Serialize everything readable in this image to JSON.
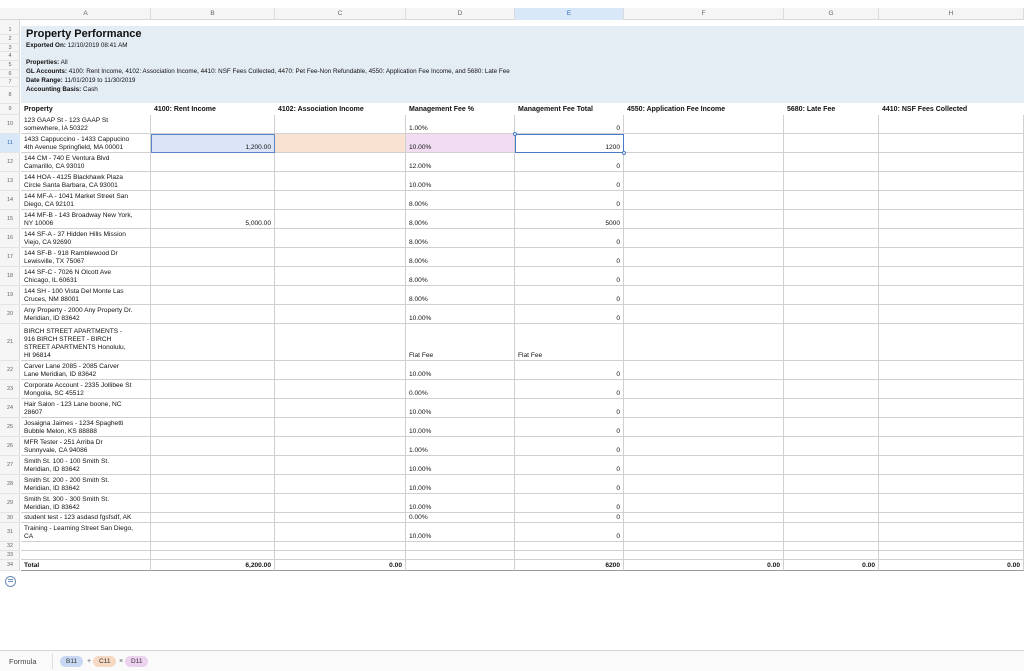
{
  "sheet": {
    "columns": [
      "A",
      "B",
      "C",
      "D",
      "E",
      "F",
      "G",
      "H"
    ],
    "active_column": "E",
    "active_row": "11",
    "row_numbers": [
      "1",
      "2",
      "3",
      "4",
      "5",
      "6",
      "7",
      "8",
      "9",
      "10",
      "11",
      "12",
      "13",
      "14",
      "15",
      "16",
      "17",
      "18",
      "19",
      "20",
      "21",
      "22",
      "23",
      "24",
      "25",
      "26",
      "27",
      "28",
      "29",
      "30",
      "31",
      "32",
      "33",
      "34"
    ]
  },
  "report": {
    "title": "Property Performance",
    "exported_label": "Exported On:",
    "exported_value": "12/10/2019 08:41 AM",
    "properties_label": "Properties:",
    "properties_value": "All",
    "gl_label": "GL Accounts:",
    "gl_value": "4100: Rent Income, 4102: Association Income, 4410: NSF Fees Collected, 4470: Pet Fee-Non Refundable, 4550: Application Fee Income, and 5680: Late Fee",
    "date_label": "Date Range:",
    "date_value": "11/01/2019 to 11/30/2019",
    "basis_label": "Accounting Basis:",
    "basis_value": "Cash"
  },
  "table": {
    "headers": [
      "Property",
      "4100: Rent Income",
      "4102: Association Income",
      "Management Fee %",
      "Management Fee Total",
      "4550: Application Fee Income",
      "5680: Late Fee",
      "4410: NSF Fees Collected"
    ],
    "rows": [
      {
        "p1": "123 GAAP St - 123 GAAP St",
        "p2": "somewhere, IA 50322",
        "p3": "",
        "p4": "",
        "b": "",
        "c": "",
        "d": "1.00%",
        "e": "0"
      },
      {
        "p1": "1433 Cappuccino - 1433 Cappucino",
        "p2": "4th Avenue Springfield, MA 00001",
        "p3": "",
        "p4": "",
        "b": "1,200.00",
        "c": "",
        "d": "10.00%",
        "e": "1200"
      },
      {
        "p1": "144 CM - 740 E Ventura Blvd",
        "p2": "Camarillo, CA 93010",
        "p3": "",
        "p4": "",
        "b": "",
        "c": "",
        "d": "12.00%",
        "e": "0"
      },
      {
        "p1": "144 HOA - 4125 Blackhawk Plaza",
        "p2": "Circle Santa Barbara, CA 93001",
        "p3": "",
        "p4": "",
        "b": "",
        "c": "",
        "d": "10.00%",
        "e": "0"
      },
      {
        "p1": "144 MF-A - 1041 Market Street San",
        "p2": "Diego, CA 92101",
        "p3": "",
        "p4": "",
        "b": "",
        "c": "",
        "d": "8.00%",
        "e": "0"
      },
      {
        "p1": "144 MF-B - 143 Broadway New York,",
        "p2": "NY 10006",
        "p3": "",
        "p4": "",
        "b": "5,000.00",
        "c": "",
        "d": "8.00%",
        "e": "5000"
      },
      {
        "p1": "144 SF-A - 37 Hidden Hills Mission",
        "p2": "Viejo, CA 92690",
        "p3": "",
        "p4": "",
        "b": "",
        "c": "",
        "d": "8.00%",
        "e": "0"
      },
      {
        "p1": "144 SF-B - 918 Ramblewood Dr",
        "p2": "Lewisville, TX 75067",
        "p3": "",
        "p4": "",
        "b": "",
        "c": "",
        "d": "8.00%",
        "e": "0"
      },
      {
        "p1": "144 SF-C - 7026 N Olcott Ave",
        "p2": "Chicago, IL 60631",
        "p3": "",
        "p4": "",
        "b": "",
        "c": "",
        "d": "8.00%",
        "e": "0"
      },
      {
        "p1": "144 SH - 100 Vista Del Monte Las",
        "p2": "Cruces, NM 88001",
        "p3": "",
        "p4": "",
        "b": "",
        "c": "",
        "d": "8.00%",
        "e": "0"
      },
      {
        "p1": "Any Property - 2000 Any Property Dr.",
        "p2": "Meridian, ID 83642",
        "p3": "",
        "p4": "",
        "b": "",
        "c": "",
        "d": "10.00%",
        "e": "0"
      },
      {
        "p1": "BIRCH STREET APARTMENTS -",
        "p2": "916 BIRCH STREET - BIRCH",
        "p3": "STREET APARTMENTS Honolulu,",
        "p4": "HI 96814",
        "b": "",
        "c": "",
        "d": "Flat Fee",
        "e": "Flat Fee"
      },
      {
        "p1": "Carver Lane 2085 - 2085 Carver",
        "p2": "Lane Meridian, ID 83642",
        "p3": "",
        "p4": "",
        "b": "",
        "c": "",
        "d": "10.00%",
        "e": "0"
      },
      {
        "p1": "Corporate Account - 2335 Jollibee St",
        "p2": "Mongolia, SC 45512",
        "p3": "",
        "p4": "",
        "b": "",
        "c": "",
        "d": "0.00%",
        "e": "0"
      },
      {
        "p1": "Hair Salon - 123 Lane boone, NC",
        "p2": "28607",
        "p3": "",
        "p4": "",
        "b": "",
        "c": "",
        "d": "10.00%",
        "e": "0"
      },
      {
        "p1": "Josaigna Jaimes - 1234 Spaghetti",
        "p2": "Bubble Melon, KS 88888",
        "p3": "",
        "p4": "",
        "b": "",
        "c": "",
        "d": "10.00%",
        "e": "0"
      },
      {
        "p1": "MFR Tester - 251 Arriba Dr",
        "p2": "Sunnyvale, CA 94086",
        "p3": "",
        "p4": "",
        "b": "",
        "c": "",
        "d": "1.00%",
        "e": "0"
      },
      {
        "p1": "Smith St. 100 - 100 Smith St.",
        "p2": "Meridian, ID 83642",
        "p3": "",
        "p4": "",
        "b": "",
        "c": "",
        "d": "10.00%",
        "e": "0"
      },
      {
        "p1": "Smith St. 200 - 200 Smith St.",
        "p2": "Meridian, ID 83642",
        "p3": "",
        "p4": "",
        "b": "",
        "c": "",
        "d": "10.00%",
        "e": "0"
      },
      {
        "p1": "Smith St. 300 - 300 Smith St.",
        "p2": "Meridian, ID 83642",
        "p3": "",
        "p4": "",
        "b": "",
        "c": "",
        "d": "10.00%",
        "e": "0"
      },
      {
        "p1": "student test - 123 asdasd fgsfsdf, AK",
        "p2": "",
        "p3": "",
        "p4": "",
        "b": "",
        "c": "",
        "d": "0.00%",
        "e": "0"
      },
      {
        "p1": "Training - Learning Street San Diego,",
        "p2": "CA",
        "p3": "",
        "p4": "",
        "b": "",
        "c": "",
        "d": "10.00%",
        "e": "0"
      }
    ],
    "total": {
      "label": "Total",
      "b": "6,200.00",
      "c": "0.00",
      "d": "",
      "e": "6200",
      "f": "0.00",
      "g": "0.00",
      "h": "0.00"
    }
  },
  "formula": {
    "label": "Formula",
    "tokens": [
      "B11",
      "C11",
      "D11"
    ],
    "operators": [
      "+",
      "×"
    ],
    "token_colors": [
      "#c9d8f2",
      "#f6d9c3",
      "#ecd2ef"
    ]
  }
}
